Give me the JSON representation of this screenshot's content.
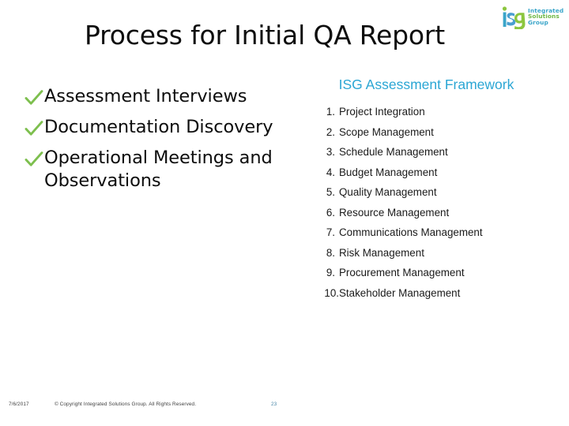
{
  "slide": {
    "title": "Process for Initial QA Report",
    "background_color": "#ffffff"
  },
  "logo": {
    "mark_text": "isg",
    "word1": "Integrated",
    "word2": "Solutions",
    "word3": "Group",
    "color_i": "#3aa5c9",
    "color_s": "#4a9fd0",
    "color_g": "#8cc63f"
  },
  "left_column": {
    "items": [
      {
        "bullet": "check-mark",
        "label": "Assessment Interviews"
      },
      {
        "bullet": "check-mark",
        "label": "Documentation Discovery"
      },
      {
        "bullet": "check-mark",
        "label": "Operational Meetings and Observations"
      }
    ],
    "bullet_color": "#7dbf4e",
    "text_color": "#0d0d0d"
  },
  "right_column": {
    "heading": "ISG Assessment Framework",
    "heading_color": "#2ba6d4",
    "items": [
      {
        "num": "1.",
        "label": "Project Integration"
      },
      {
        "num": "2.",
        "label": "Scope Management"
      },
      {
        "num": "3.",
        "label": "Schedule Management"
      },
      {
        "num": "4.",
        "label": "Budget Management"
      },
      {
        "num": "5.",
        "label": "Quality Management"
      },
      {
        "num": "6.",
        "label": "Resource Management"
      },
      {
        "num": "7.",
        "label": "Communications Management"
      },
      {
        "num": "8.",
        "label": "Risk Management"
      },
      {
        "num": "9.",
        "label": "Procurement Management"
      },
      {
        "num": "10.",
        "label": "Stakeholder Management"
      }
    ]
  },
  "footer": {
    "date": "7/6/2017",
    "copyright": "© Copyright Integrated Solutions Group. All Rights Reserved.",
    "page_number": "23",
    "page_number_color": "#4a87a8"
  }
}
